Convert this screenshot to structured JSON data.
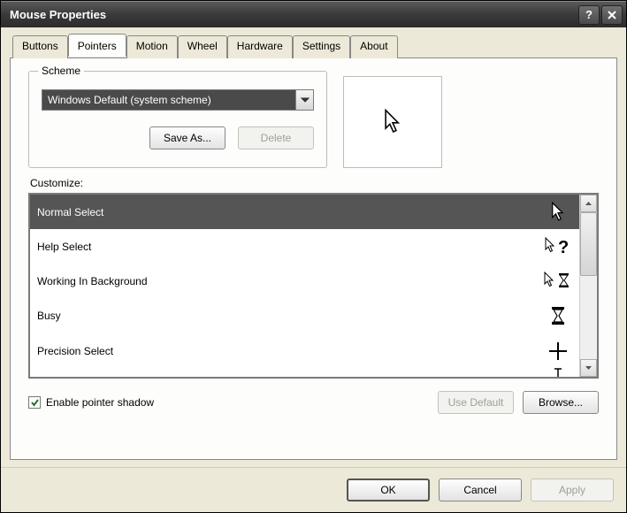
{
  "window": {
    "title": "Mouse Properties"
  },
  "tabs": [
    "Buttons",
    "Pointers",
    "Motion",
    "Wheel",
    "Hardware",
    "Settings",
    "About"
  ],
  "selectedTab": 1,
  "scheme": {
    "legend": "Scheme",
    "selected": "Windows Default (system scheme)",
    "saveAs": "Save As...",
    "delete": "Delete"
  },
  "customizeLabel": "Customize:",
  "pointerList": [
    {
      "label": "Normal Select",
      "icon": "arrow",
      "selected": true
    },
    {
      "label": "Help Select",
      "icon": "arrow-help",
      "selected": false
    },
    {
      "label": "Working In Background",
      "icon": "arrow-hourglass",
      "selected": false
    },
    {
      "label": "Busy",
      "icon": "hourglass",
      "selected": false
    },
    {
      "label": "Precision Select",
      "icon": "crosshair",
      "selected": false
    }
  ],
  "nextPartialIcon": "ibeam",
  "enableShadow": {
    "label": "Enable pointer shadow",
    "checked": true
  },
  "useDefault": "Use Default",
  "browse": "Browse...",
  "footer": {
    "ok": "OK",
    "cancel": "Cancel",
    "apply": "Apply"
  }
}
